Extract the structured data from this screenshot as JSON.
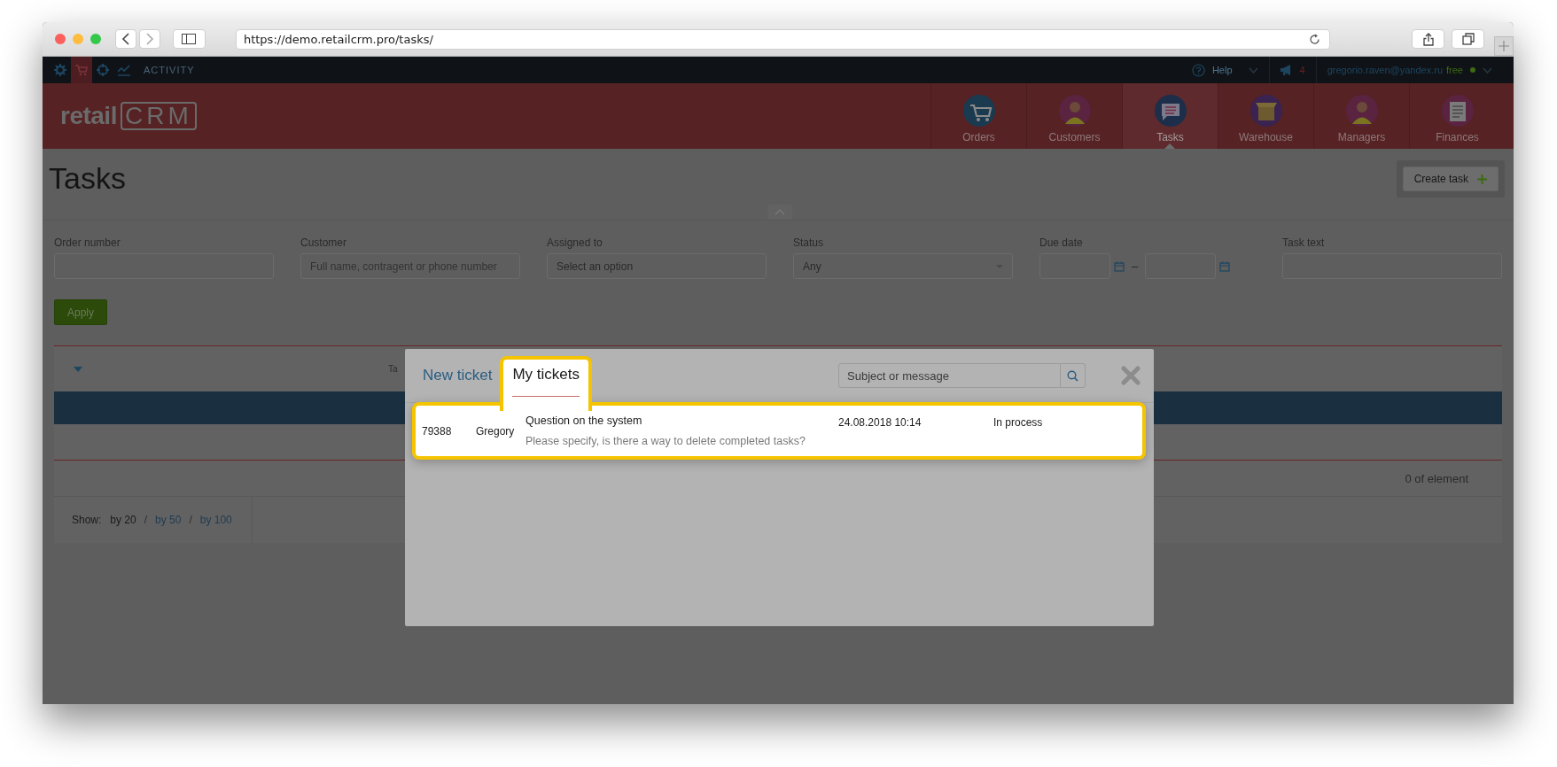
{
  "browser": {
    "url": "https://demo.retailcrm.pro/tasks/"
  },
  "top_bar": {
    "icons": [
      {
        "kind": "gear",
        "selected": false
      },
      {
        "kind": "cart",
        "selected": true
      },
      {
        "kind": "target",
        "selected": false
      },
      {
        "kind": "chart",
        "selected": false
      }
    ],
    "activity": "ACTIVITY",
    "help": "Help",
    "notifications": "4",
    "user_email": "gregorio.raven@yandex.ru",
    "plan": "free"
  },
  "header": {
    "logo": {
      "word": "retail",
      "mark": "CRM"
    },
    "nav": [
      {
        "label": "Orders",
        "kind": "cart",
        "selected": false
      },
      {
        "label": "Customers",
        "kind": "person",
        "selected": false
      },
      {
        "label": "Tasks",
        "kind": "chat",
        "selected": true
      },
      {
        "label": "Warehouse",
        "kind": "box",
        "selected": false
      },
      {
        "label": "Managers",
        "kind": "person",
        "selected": false
      },
      {
        "label": "Finances",
        "kind": "document",
        "selected": false
      }
    ]
  },
  "page": {
    "title": "Tasks",
    "create_button": "Create task",
    "filters": [
      {
        "label": "Order number",
        "kind": "text"
      },
      {
        "label": "Customer",
        "kind": "text",
        "placeholder": "Full name, contragent or phone number"
      },
      {
        "label": "Assigned to",
        "kind": "select",
        "value": "Select an option"
      },
      {
        "label": "Status",
        "kind": "dropdown",
        "value": "Any"
      },
      {
        "label": "Due date",
        "kind": "daterange",
        "separator": "–"
      },
      {
        "label": "Task text",
        "kind": "text"
      }
    ],
    "apply_button": "Apply"
  },
  "table": {
    "column_1": "Ta",
    "total": "0 of element",
    "page_size": {
      "label": "Show:",
      "separators": [
        "/",
        "/"
      ],
      "options": [
        {
          "label": "by 20",
          "selected": true
        },
        {
          "label": "by 50",
          "selected": false
        },
        {
          "label": "by 100",
          "selected": false
        }
      ]
    }
  },
  "modal": {
    "tabs": [
      {
        "label": "New ticket",
        "selected": false
      },
      {
        "label": "My tickets",
        "selected": true
      }
    ],
    "search": {
      "placeholder": "Subject or message"
    },
    "tickets": [
      {
        "id": "79388",
        "author": "Gregory",
        "subject": "Question on the system",
        "message": "Please specify, is there a way to delete completed tasks?",
        "date": "24.08.2018 10:14",
        "status": "In process",
        "highlighted": true
      }
    ]
  }
}
